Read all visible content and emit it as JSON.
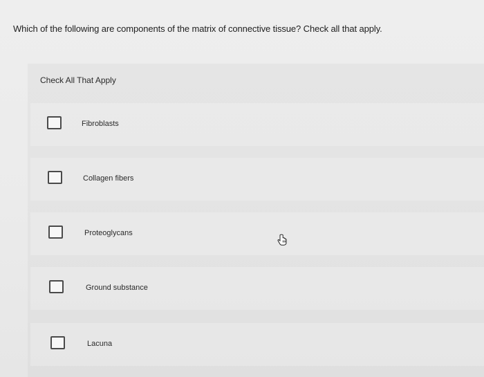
{
  "question": {
    "text": "Which of the following are components of the matrix of connective tissue? Check all that apply."
  },
  "panel": {
    "header": "Check All That Apply"
  },
  "options": [
    {
      "label": "Fibroblasts",
      "checked": false
    },
    {
      "label": "Collagen fibers",
      "checked": false
    },
    {
      "label": "Proteoglycans",
      "checked": false
    },
    {
      "label": "Ground substance",
      "checked": false
    },
    {
      "label": "Lacuna",
      "checked": false
    }
  ],
  "cursor": {
    "icon": "hand-pointer-icon"
  }
}
